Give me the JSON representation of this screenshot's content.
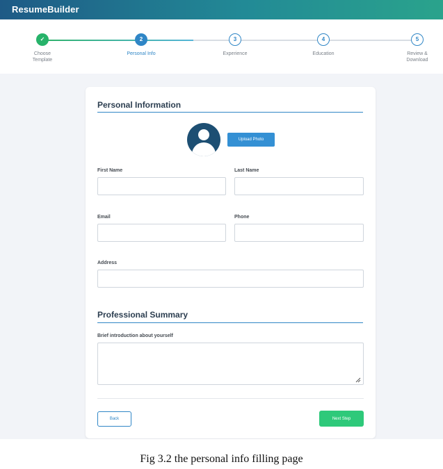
{
  "app": {
    "brand": "ResumeBuilder"
  },
  "stepper": {
    "current_step": 2,
    "steps": [
      {
        "number": "✓",
        "label": "Choose Template",
        "state": "done"
      },
      {
        "number": "2",
        "label": "Personal Info",
        "state": "active"
      },
      {
        "number": "3",
        "label": "Experience",
        "state": "todo"
      },
      {
        "number": "4",
        "label": "Education",
        "state": "todo"
      },
      {
        "number": "5",
        "label": "Review & Download",
        "state": "todo"
      }
    ]
  },
  "personal_info": {
    "title": "Personal Information",
    "upload_label": "Upload Photo",
    "avatar_icon": "user-avatar-icon",
    "fields": {
      "first_name": {
        "label": "First Name",
        "value": "",
        "placeholder": ""
      },
      "last_name": {
        "label": "Last Name",
        "value": "",
        "placeholder": ""
      },
      "email": {
        "label": "Email",
        "value": "",
        "placeholder": ""
      },
      "phone": {
        "label": "Phone",
        "value": "",
        "placeholder": ""
      },
      "address": {
        "label": "Address",
        "value": "",
        "placeholder": ""
      }
    }
  },
  "summary": {
    "title": "Professional Summary",
    "label": "Brief introduction about yourself",
    "value": "",
    "placeholder": ""
  },
  "actions": {
    "back_label": "Back",
    "next_label": "Next Step"
  },
  "caption": "Fig 3.2 the personal info filling page",
  "colors": {
    "primary": "#2f86c6",
    "success": "#2ec97a",
    "done_step": "#27b36a",
    "avatar": "#1d4f73",
    "heading": "#2c3e50"
  }
}
